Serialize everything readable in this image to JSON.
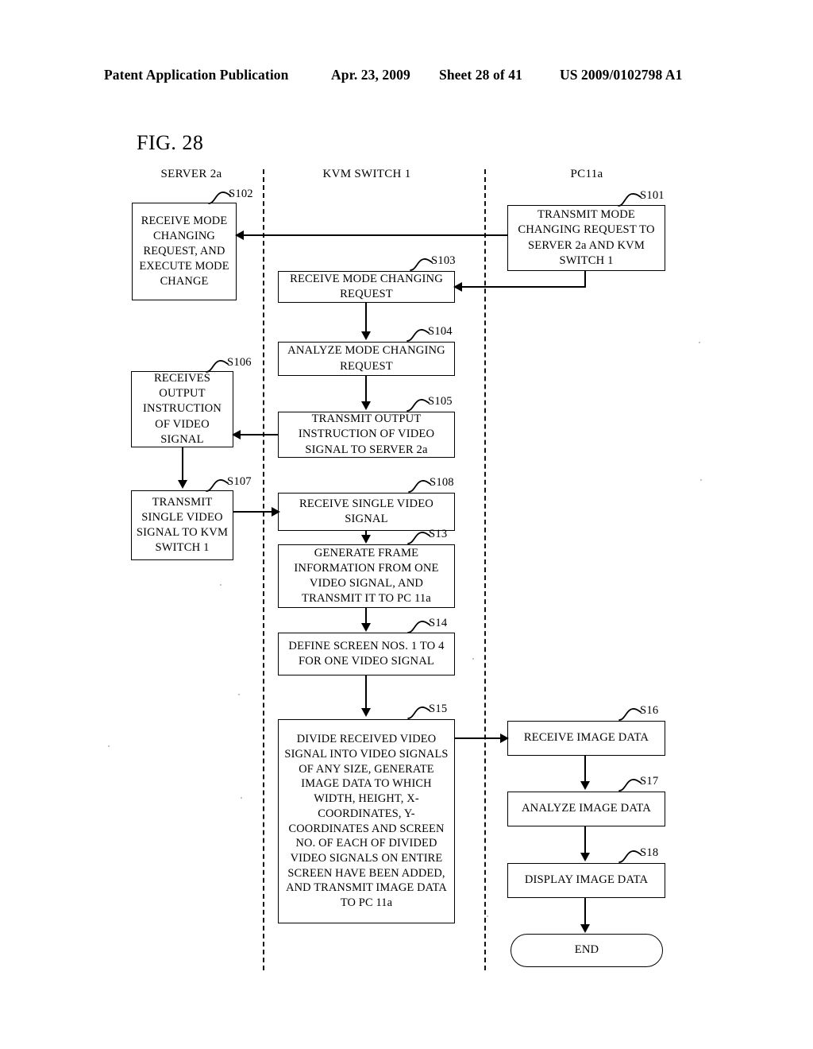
{
  "header": {
    "left": "Patent Application Publication",
    "date": "Apr. 23, 2009",
    "sheet": "Sheet 28 of 41",
    "pub_number": "US 2009/0102798 A1"
  },
  "figure": {
    "label": "FIG. 28"
  },
  "lanes": [
    {
      "id": "server",
      "title": "SERVER 2a"
    },
    {
      "id": "kvm",
      "title": "KVM SWITCH 1"
    },
    {
      "id": "pc",
      "title": "PC11a"
    }
  ],
  "nodes": [
    {
      "id": "s101",
      "tag": "S101",
      "lane": "pc",
      "text": "TRANSMIT MODE CHANGING REQUEST TO SERVER 2a AND KVM SWITCH 1"
    },
    {
      "id": "s102",
      "tag": "S102",
      "lane": "server",
      "text": "RECEIVE MODE CHANGING REQUEST, AND EXECUTE MODE CHANGE"
    },
    {
      "id": "s103",
      "tag": "S103",
      "lane": "kvm",
      "text": "RECEIVE MODE CHANGING REQUEST"
    },
    {
      "id": "s104",
      "tag": "S104",
      "lane": "kvm",
      "text": "ANALYZE MODE CHANGING REQUEST"
    },
    {
      "id": "s105",
      "tag": "S105",
      "lane": "kvm",
      "text": "TRANSMIT OUTPUT INSTRUCTION OF VIDEO SIGNAL TO SERVER 2a"
    },
    {
      "id": "s106",
      "tag": "S106",
      "lane": "server",
      "text": "RECEIVES OUTPUT INSTRUCTION OF VIDEO SIGNAL"
    },
    {
      "id": "s107",
      "tag": "S107",
      "lane": "server",
      "text": "TRANSMIT SINGLE VIDEO SIGNAL TO KVM SWITCH 1"
    },
    {
      "id": "s108",
      "tag": "S108",
      "lane": "kvm",
      "text": "RECEIVE SINGLE VIDEO SIGNAL"
    },
    {
      "id": "s13",
      "tag": "S13",
      "lane": "kvm",
      "text": "GENERATE FRAME INFORMATION FROM ONE VIDEO SIGNAL, AND TRANSMIT IT TO PC 11a"
    },
    {
      "id": "s14",
      "tag": "S14",
      "lane": "kvm",
      "text": "DEFINE SCREEN NOS. 1 TO 4 FOR ONE VIDEO SIGNAL"
    },
    {
      "id": "s15",
      "tag": "S15",
      "lane": "kvm",
      "text": "DIVIDE RECEIVED VIDEO SIGNAL INTO VIDEO SIGNALS OF ANY SIZE, GENERATE IMAGE DATA TO WHICH WIDTH, HEIGHT, X-COORDINATES, Y-COORDINATES AND SCREEN NO. OF EACH OF DIVIDED VIDEO SIGNALS ON ENTIRE SCREEN HAVE BEEN ADDED, AND TRANSMIT IMAGE DATA TO PC 11a"
    },
    {
      "id": "s16",
      "tag": "S16",
      "lane": "pc",
      "text": "RECEIVE IMAGE DATA"
    },
    {
      "id": "s17",
      "tag": "S17",
      "lane": "pc",
      "text": "ANALYZE IMAGE DATA"
    },
    {
      "id": "s18",
      "tag": "S18",
      "lane": "pc",
      "text": "DISPLAY IMAGE DATA"
    },
    {
      "id": "end",
      "tag": "",
      "lane": "pc",
      "text": "END"
    }
  ]
}
